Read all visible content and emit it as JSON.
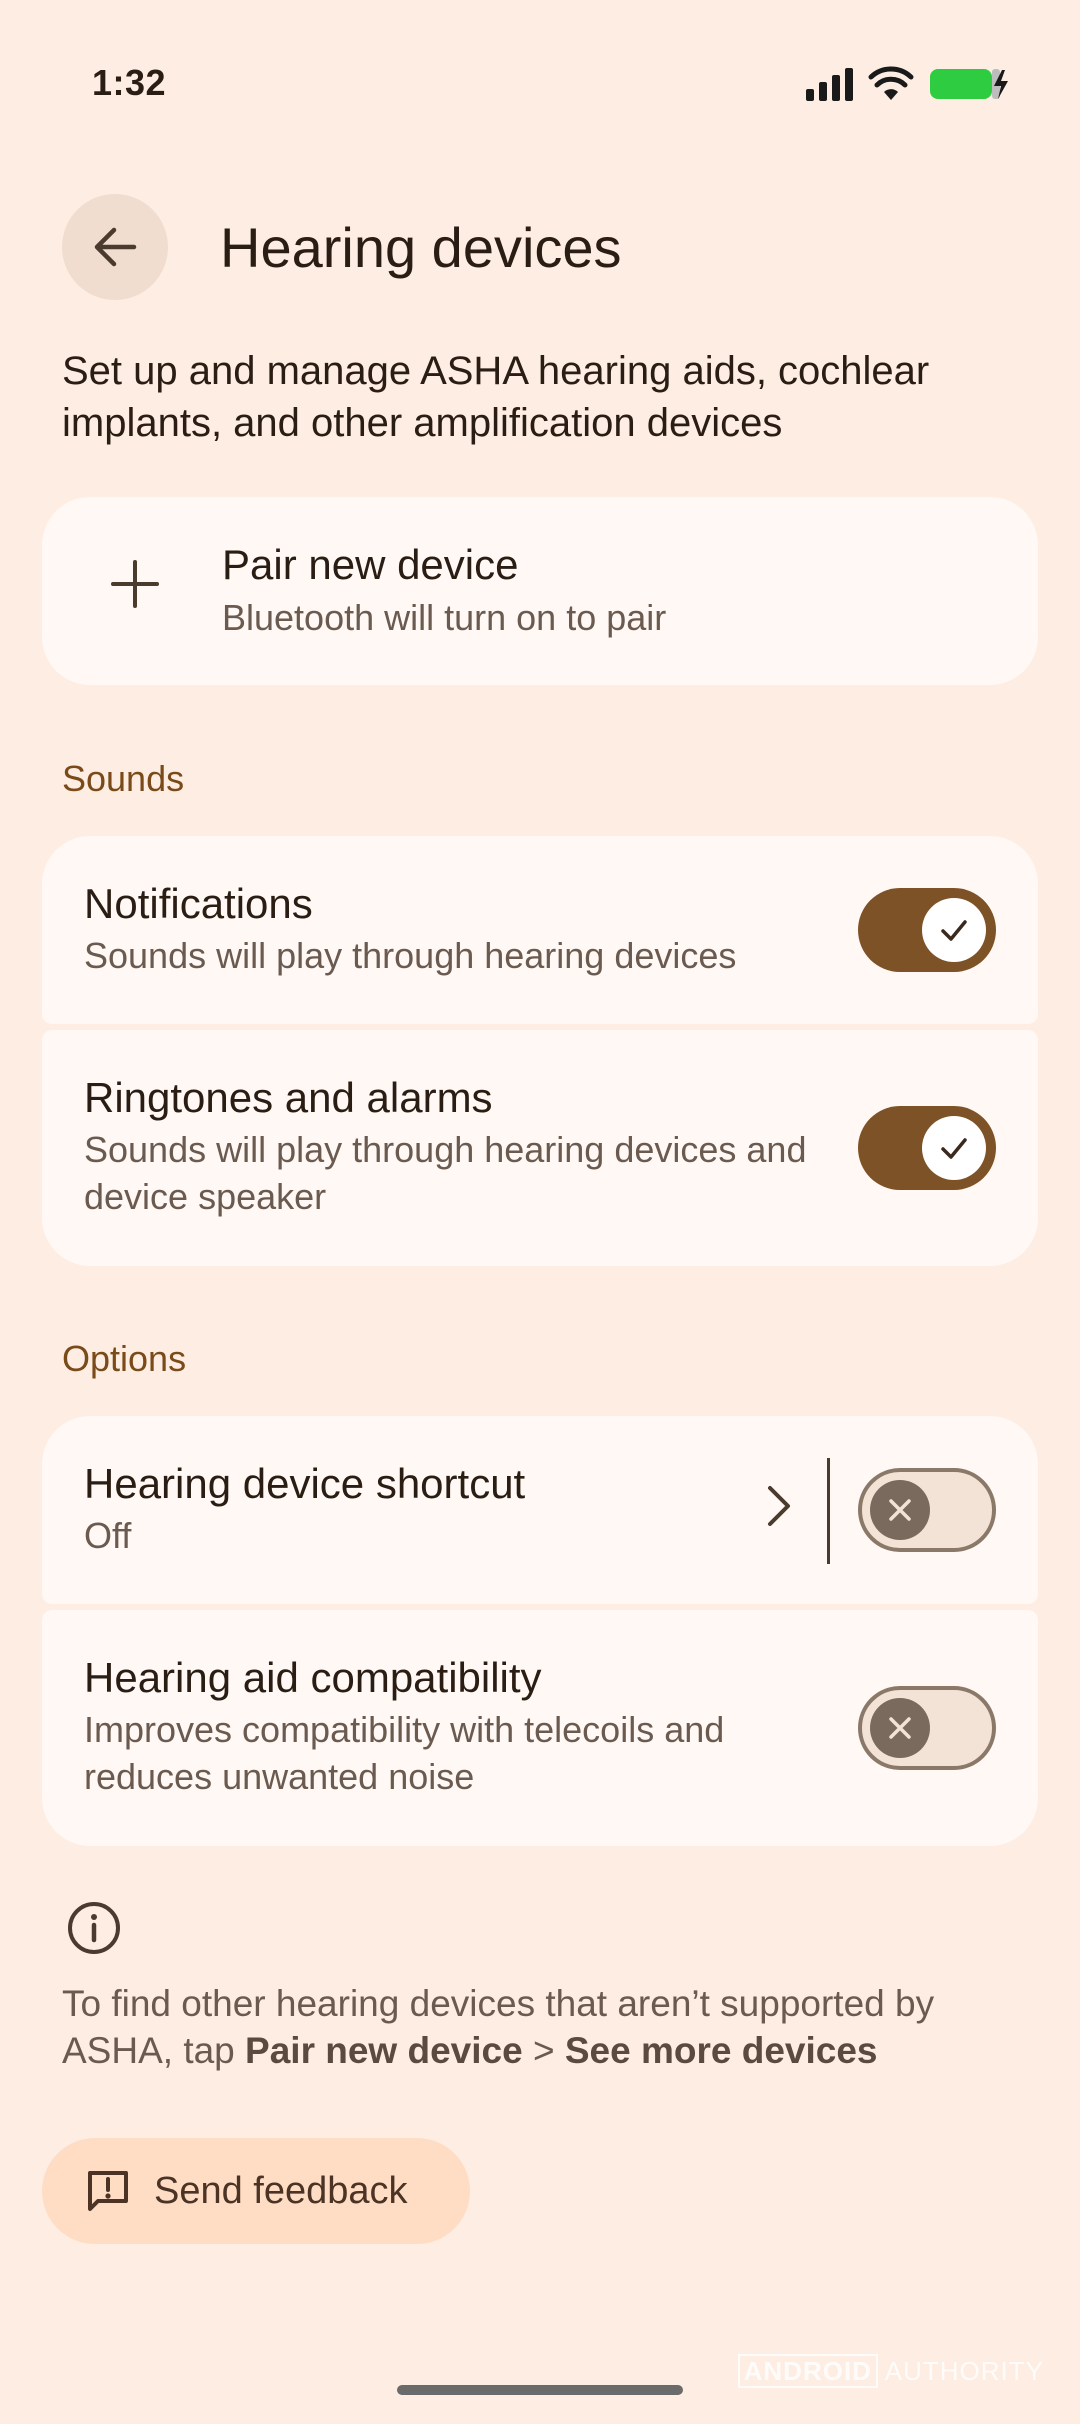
{
  "status_bar": {
    "time": "1:32"
  },
  "header": {
    "title": "Hearing devices"
  },
  "description": "Set up and manage ASHA hearing aids, cochlear implants, and other amplification devices",
  "pair_device": {
    "title": "Pair new device",
    "subtitle": "Bluetooth will turn on to pair"
  },
  "sounds": {
    "label": "Sounds",
    "items": [
      {
        "title": "Notifications",
        "subtitle": "Sounds will play through hearing devices",
        "enabled": true
      },
      {
        "title": "Ringtones and alarms",
        "subtitle": "Sounds will play through hearing devices and device speaker",
        "enabled": true
      }
    ]
  },
  "options": {
    "label": "Options",
    "items": [
      {
        "title": "Hearing device shortcut",
        "subtitle": "Off",
        "enabled": false
      },
      {
        "title": "Hearing aid compatibility",
        "subtitle": "Improves compatibility with telecoils and reduces unwanted noise",
        "enabled": false
      }
    ]
  },
  "footer": {
    "text_prefix": "To find other hearing devices that aren’t supported by ASHA, tap ",
    "bold_1": "Pair new device",
    "separator": " > ",
    "bold_2": "See more devices"
  },
  "feedback": {
    "label": "Send feedback"
  },
  "watermark": {
    "part1": "ANDROID",
    "part2": "AUTHORITY"
  },
  "colors": {
    "background": "#FDEDE2",
    "card": "#FFF8F4",
    "accent": "#7D5227",
    "section_label": "#7A4A19",
    "battery": "#2ECC40"
  }
}
